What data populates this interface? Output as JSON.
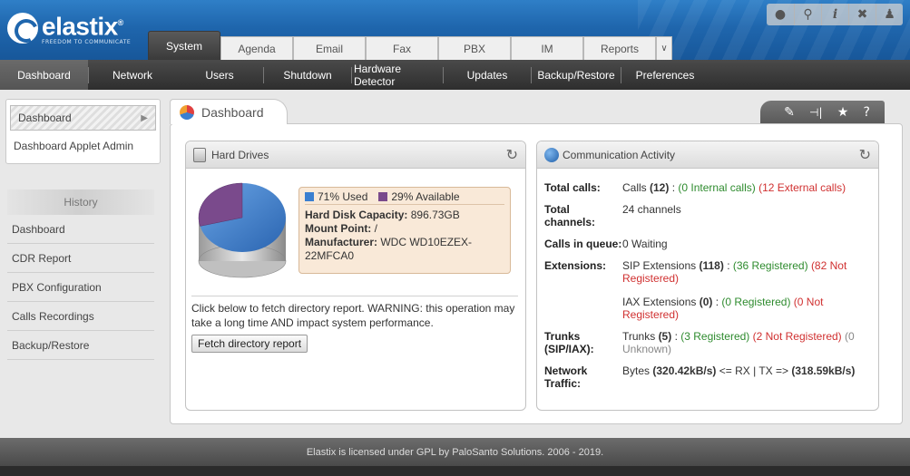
{
  "logo": {
    "name": "elastix",
    "trademark": "®",
    "tagline": "FREEDOM TO COMMUNICATE"
  },
  "tools": [
    {
      "name": "water-drop-icon",
      "glyph": "💧"
    },
    {
      "name": "search-icon",
      "glyph": "🔍"
    },
    {
      "name": "info-icon",
      "glyph": "ℹ"
    },
    {
      "name": "wrench-icon",
      "glyph": "🔧"
    },
    {
      "name": "user-icon",
      "glyph": "👤"
    }
  ],
  "main_tabs": [
    "System",
    "Agenda",
    "Email",
    "Fax",
    "PBX",
    "IM",
    "Reports"
  ],
  "main_tab_more": "∨",
  "sub_nav": [
    "Dashboard",
    "Network",
    "Users",
    "Shutdown",
    "Hardware Detector",
    "Updates",
    "Backup/Restore",
    "Preferences"
  ],
  "sidebar": {
    "top_links": [
      "Dashboard",
      "Dashboard Applet Admin"
    ],
    "history_header": "History",
    "history": [
      "Dashboard",
      "CDR Report",
      "PBX Configuration",
      "Calls Recordings",
      "Backup/Restore"
    ]
  },
  "dashboard": {
    "title": "Dashboard",
    "tool_icons": [
      "✎",
      "⊣|",
      "★",
      "?"
    ]
  },
  "hard_drives": {
    "title": "Hard Drives",
    "used_label": "71% Used",
    "available_label": "29% Available",
    "used_fraction": 0.71,
    "colors": {
      "used": "#3a7fd0",
      "available": "#7a4a8c"
    },
    "capacity_label": "Hard Disk Capacity:",
    "capacity_value": "896.73GB",
    "mount_label": "Mount Point:",
    "mount_value": "/",
    "manufacturer_label": "Manufacturer:",
    "manufacturer_value": "WDC WD10EZEX-22MFCA0",
    "description": "Click below to fetch directory report. WARNING: this operation may take a long time AND impact system performance.",
    "fetch_button": "Fetch directory report"
  },
  "comm": {
    "title": "Communication Activity",
    "total_calls": {
      "label": "Total calls:",
      "prefix": "Calls ",
      "count": "(12)",
      "sep": " : ",
      "internal": "(0 Internal calls)",
      "external": "(12 External calls)"
    },
    "total_channels": {
      "label": "Total channels:",
      "value": "24 channels"
    },
    "calls_queue": {
      "label": "Calls in queue:",
      "value": "0 Waiting"
    },
    "extensions": {
      "label": "Extensions:",
      "sip_prefix": "SIP Extensions ",
      "sip_count": "(118)",
      "sip_sep": " : ",
      "sip_registered": "(36 Registered)",
      "sip_not": "(82 Not Registered)",
      "iax_prefix": "IAX Extensions ",
      "iax_count": "(0)",
      "iax_sep": " : ",
      "iax_registered": "(0 Registered)",
      "iax_not": "(0 Not Registered)"
    },
    "trunks": {
      "label": "Trunks (SIP/IAX):",
      "prefix": "Trunks ",
      "count": "(5)",
      "sep": " : ",
      "registered": "(3 Registered)",
      "not": "(2 Not Registered)",
      "unknown": "(0 Unknown)"
    },
    "network": {
      "label": "Network Traffic:",
      "prefix": "Bytes ",
      "rx": "(320.42kB/s)",
      "mid": " <= RX | TX => ",
      "tx": "(318.59kB/s)"
    }
  },
  "footer": "Elastix is licensed under GPL by PaloSanto Solutions. 2006 - 2019."
}
